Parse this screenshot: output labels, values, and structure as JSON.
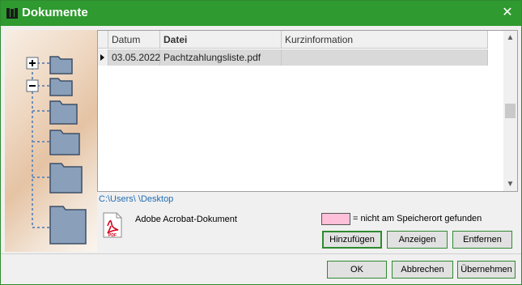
{
  "window": {
    "title": "Dokumente",
    "close_glyph": "✕"
  },
  "grid": {
    "columns": [
      "Datum",
      "Datei",
      "Kurzinformation"
    ],
    "rows": [
      {
        "datum": "03.05.2022",
        "datei": "Pachtzahlungsliste.pdf",
        "kurzinformation": ""
      }
    ]
  },
  "path": "C:\\Users\\          \\Desktop",
  "document_type": "Adobe Acrobat-Dokument",
  "legend": {
    "text": "= nicht am Speicherort gefunden",
    "color": "#ffc0d9"
  },
  "buttons": {
    "add": "Hinzufügen",
    "show": "Anzeigen",
    "remove": "Entfernen",
    "ok": "OK",
    "cancel": "Abbrechen",
    "apply": "Übernehmen"
  },
  "icons": {
    "pdf_label": "PDF"
  }
}
